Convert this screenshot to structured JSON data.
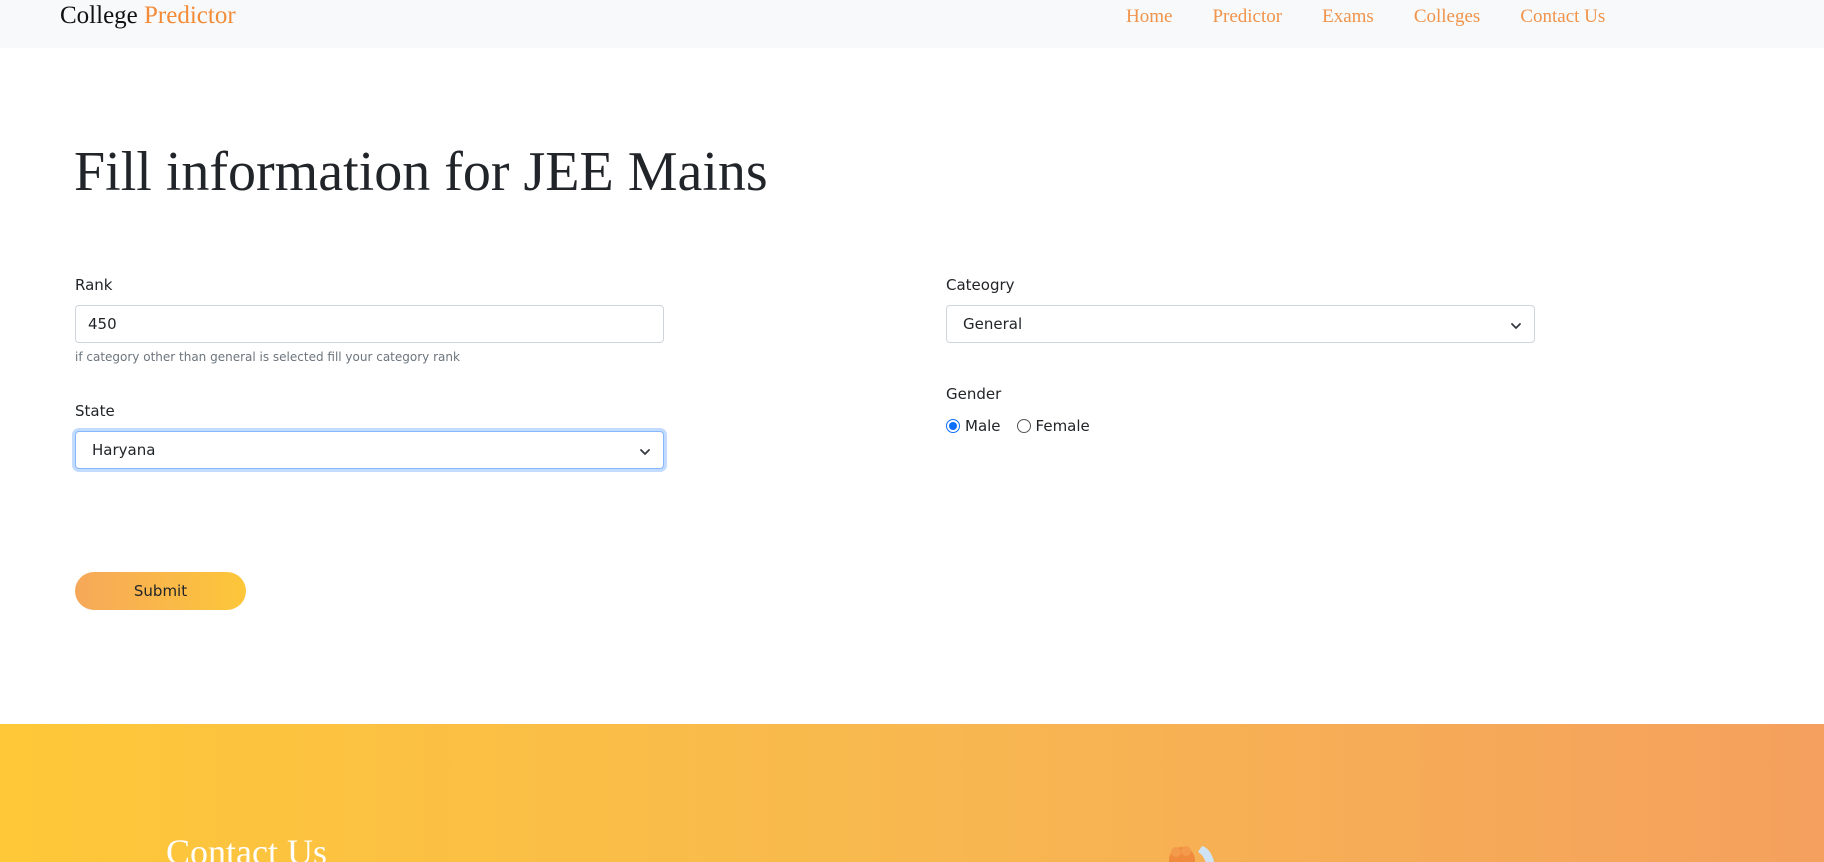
{
  "navbar": {
    "brand_part1": "College",
    "brand_part2": "Predictor",
    "links": [
      "Home",
      "Predictor",
      "Exams",
      "Colleges",
      "Contact Us"
    ]
  },
  "main": {
    "title": "Fill information for JEE Mains",
    "rank": {
      "label": "Rank",
      "value": "450",
      "help": "if category other than general is selected fill your category rank"
    },
    "state": {
      "label": "State",
      "selected": "Haryana"
    },
    "category": {
      "label": "Cateogry",
      "selected": "General"
    },
    "gender": {
      "label": "Gender",
      "options": [
        "Male",
        "Female"
      ],
      "selected": "Male"
    },
    "submit_label": "Submit"
  },
  "footer": {
    "title": "Contact Us"
  },
  "colors": {
    "accent": "#f28c38",
    "nav_link": "#f0934b",
    "footer_start": "#fec838",
    "footer_end": "#f5a05e",
    "focus": "#86b7fe",
    "radio_checked": "#0d6efd"
  },
  "icons": {
    "select_indicator": "chevron-down-icon",
    "footer_art": "illustration-icon"
  }
}
